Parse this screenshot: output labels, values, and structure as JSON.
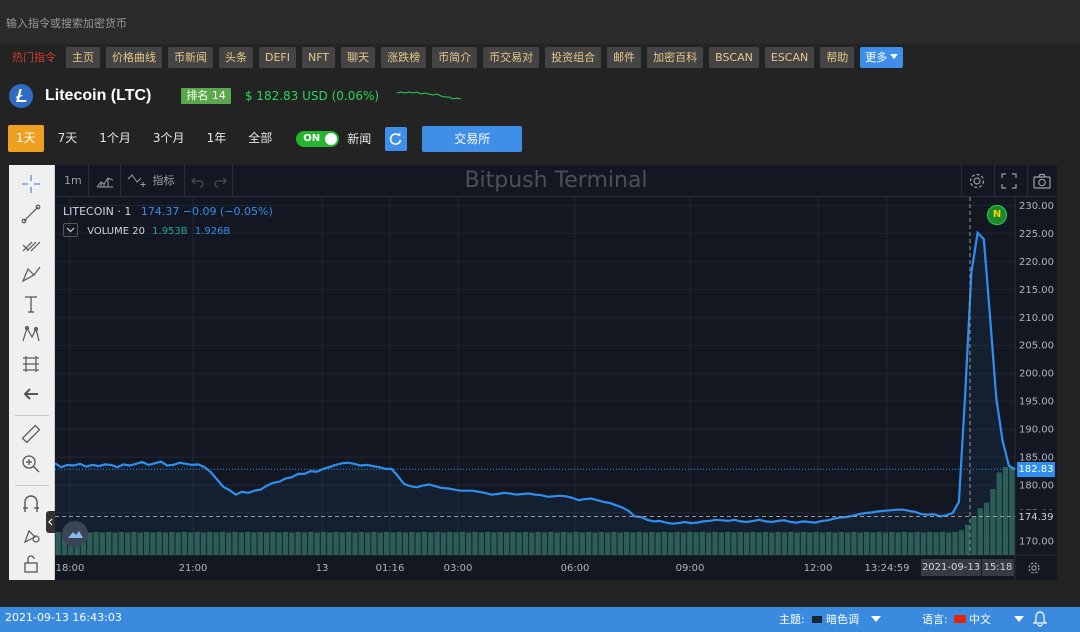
{
  "search": {
    "placeholder": "输入指令或搜索加密货币"
  },
  "hot": {
    "label": "热门指令",
    "items": [
      "主页",
      "价格曲线",
      "币新闻",
      "头条",
      "DEFI",
      "NFT",
      "聊天",
      "涨跌榜",
      "币简介",
      "币交易对",
      "投资组合",
      "邮件",
      "加密百科",
      "BSCAN",
      "ESCAN",
      "帮助"
    ],
    "more": "更多"
  },
  "coin": {
    "name": "Litecoin (LTC)",
    "rank": "排名 14",
    "price": "$ 182.83 USD (0.06%)",
    "logo_icon": "litecoin-logo",
    "price_color": "#29d45a"
  },
  "range": {
    "buttons": [
      "1天",
      "7天",
      "1个月",
      "3个月",
      "1年",
      "全部"
    ],
    "active": "1天",
    "toggle": "ON",
    "news": "新闻",
    "exchange": "交易所"
  },
  "toolbar": {
    "interval": "1m",
    "indicators": "指标",
    "brand": "Bitpush Terminal"
  },
  "legend": {
    "symbol": "LITECOIN · 1",
    "ohlc": "174.37  −0.09 (−0.05%)",
    "volume_label": "VOLUME 20",
    "volume_a": "1.953B",
    "volume_b": "1.926B"
  },
  "event_badge": "N",
  "labels": {
    "last_price": "182.83",
    "ref_price": "174.39",
    "crosshair_date": "2021-09-13",
    "crosshair_time": "15:18"
  },
  "chart_data": {
    "type": "line",
    "title": "",
    "xlabel": "",
    "ylabel": "",
    "ylim": [
      167.5,
      231.5
    ],
    "y_ticks": [
      170,
      175,
      180,
      185,
      190,
      195,
      200,
      205,
      210,
      215,
      220,
      225,
      230
    ],
    "x_ticks": [
      "18:00",
      "21:00",
      "13",
      "01:16",
      "03:00",
      "06:00",
      "09:00",
      "12:00",
      "13:24:59",
      "2021-09-13",
      "15:18"
    ],
    "grid": true,
    "series": [
      {
        "name": "",
        "color": "#2f8ff0",
        "values": [
          183.9,
          183.2,
          183.6,
          183.5,
          183.8,
          183.3,
          183.6,
          183.4,
          183.7,
          183.6,
          183.2,
          183.7,
          183.5,
          183.8,
          184.1,
          183.6,
          183.9,
          184.2,
          183.5,
          183.6,
          184.0,
          183.8,
          183.6,
          183.7,
          183.2,
          182.3,
          181.0,
          179.7,
          179.1,
          178.3,
          178.8,
          178.6,
          179.0,
          179.2,
          179.9,
          180.4,
          180.6,
          181.2,
          181.4,
          182.0,
          182.0,
          182.5,
          182.4,
          182.9,
          183.2,
          183.6,
          183.9,
          184.0,
          183.8,
          183.5,
          183.6,
          183.4,
          183.2,
          182.9,
          182.9,
          181.6,
          180.2,
          179.8,
          179.6,
          179.9,
          180.1,
          179.8,
          179.5,
          179.4,
          179.2,
          179.0,
          179.0,
          179.0,
          178.8,
          178.6,
          178.3,
          178.4,
          178.6,
          178.5,
          178.3,
          178.4,
          178.5,
          178.3,
          178.2,
          177.9,
          178.0,
          178.1,
          178.0,
          177.7,
          177.3,
          177.5,
          177.6,
          177.3,
          177.0,
          176.8,
          176.4,
          176.0,
          175.4,
          174.4,
          174.3,
          173.8,
          173.5,
          173.6,
          173.3,
          173.1,
          173.2,
          173.4,
          173.2,
          173.3,
          173.5,
          173.6,
          173.8,
          173.7,
          173.6,
          173.8,
          173.5,
          173.4,
          173.6,
          173.8,
          173.5,
          173.4,
          173.6,
          173.7,
          173.4,
          173.3,
          173.5,
          173.4,
          173.3,
          173.6,
          173.7,
          174.0,
          174.2,
          174.3,
          174.5,
          174.8,
          175.0,
          175.1,
          175.3,
          175.4,
          175.5,
          175.6,
          175.6,
          175.4,
          175.2,
          174.8,
          174.7,
          174.8,
          174.4,
          174.6,
          175.0,
          177.0,
          196.0,
          218.0,
          225.1,
          224.0,
          210.0,
          195.5,
          188.0,
          183.5,
          182.8
        ]
      }
    ],
    "volume": {
      "name": "VOLUME 20",
      "color": "#2e5a4c",
      "heights": [
        0.42,
        0.41,
        0.42,
        0.41,
        0.42,
        0.41,
        0.42,
        0.41,
        0.42,
        0.41,
        0.42,
        0.41,
        0.42,
        0.41,
        0.42,
        0.41,
        0.42,
        0.41,
        0.42,
        0.41,
        0.42,
        0.41,
        0.42,
        0.41,
        0.42,
        0.41,
        0.42,
        0.41,
        0.42,
        0.41,
        0.42,
        0.41,
        0.42,
        0.41,
        0.42,
        0.41,
        0.42,
        0.41,
        0.42,
        0.41,
        0.42,
        0.41,
        0.42,
        0.41,
        0.42,
        0.41,
        0.42,
        0.41,
        0.42,
        0.41,
        0.42,
        0.41,
        0.42,
        0.41,
        0.42,
        0.41,
        0.42,
        0.41,
        0.42,
        0.41,
        0.42,
        0.41,
        0.42,
        0.41,
        0.42,
        0.41,
        0.42,
        0.41,
        0.42,
        0.41,
        0.42,
        0.41,
        0.42,
        0.41,
        0.42,
        0.41,
        0.42,
        0.41,
        0.42,
        0.41,
        0.42,
        0.41,
        0.42,
        0.41,
        0.42,
        0.41,
        0.42,
        0.41,
        0.42,
        0.41,
        0.42,
        0.41,
        0.42,
        0.41,
        0.42,
        0.41,
        0.42,
        0.41,
        0.42,
        0.41,
        0.42,
        0.41,
        0.42,
        0.41,
        0.42,
        0.41,
        0.42,
        0.41,
        0.42,
        0.41,
        0.42,
        0.41,
        0.42,
        0.41,
        0.42,
        0.41,
        0.42,
        0.41,
        0.42,
        0.41,
        0.42,
        0.41,
        0.42,
        0.41,
        0.42,
        0.41,
        0.42,
        0.41,
        0.42,
        0.41,
        0.42,
        0.41,
        0.42,
        0.41,
        0.42,
        0.41,
        0.42,
        0.41,
        0.42,
        0.41,
        0.42,
        0.41,
        0.42,
        0.45,
        0.55,
        0.7,
        0.85,
        0.95,
        1.2,
        1.5,
        1.6,
        1.6
      ]
    }
  },
  "status": {
    "datetime": "2021-09-13 16:43:03",
    "theme_label": "主题:",
    "theme_value": "暗色调",
    "lang_label": "语言:",
    "lang_value": "中文"
  }
}
